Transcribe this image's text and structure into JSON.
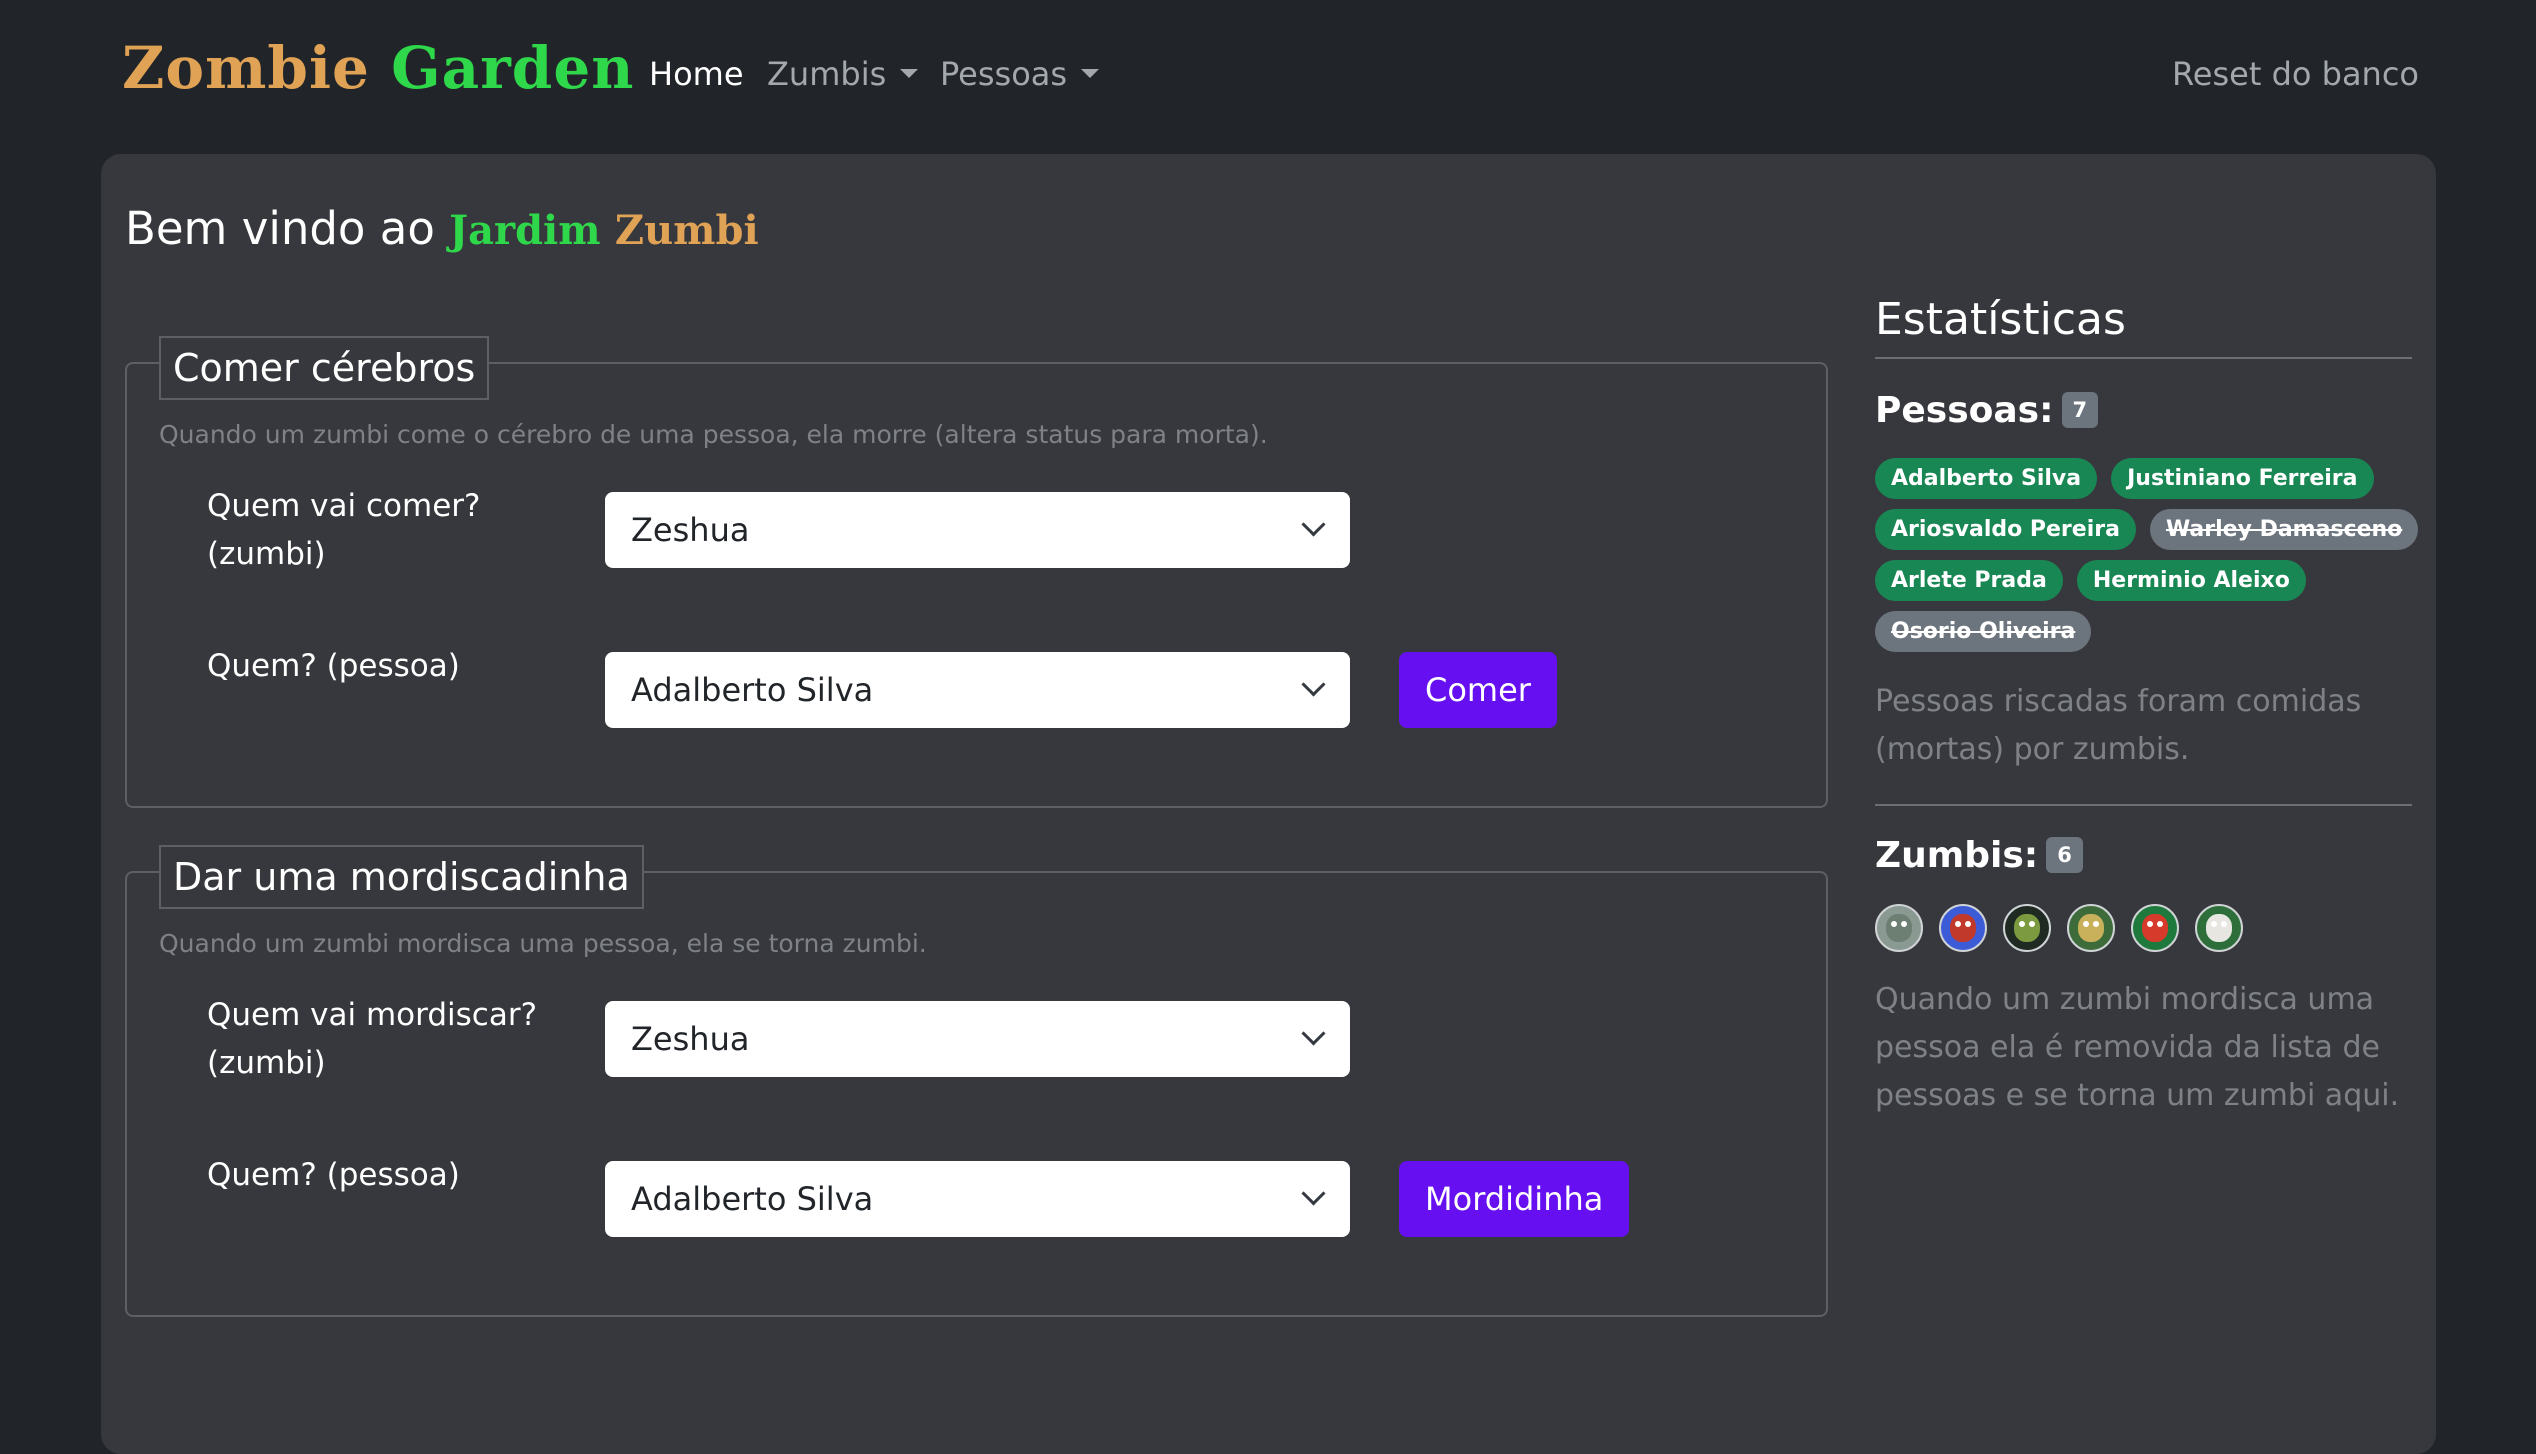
{
  "nav": {
    "brand_word1": "Zombie",
    "brand_word2": "Garden",
    "home": "Home",
    "zumbis": "Zumbis",
    "pessoas": "Pessoas",
    "reset": "Reset do banco"
  },
  "main": {
    "welcome_prefix": "Bem vindo ao",
    "welcome_jardim": "Jardim",
    "welcome_zumbi": "Zumbi"
  },
  "eat": {
    "legend": "Comer cérebros",
    "description": "Quando um zumbi come o cérebro de uma pessoa, ela morre (altera status para morta).",
    "zombie_label_line1": "Quem vai comer?",
    "zombie_label_line2": "(zumbi)",
    "zombie_value": "Zeshua",
    "person_label": "Quem? (pessoa)",
    "person_value": "Adalberto Silva",
    "button": "Comer"
  },
  "bite": {
    "legend": "Dar uma mordiscadinha",
    "description": "Quando um zumbi mordisca uma pessoa, ela se torna zumbi.",
    "zombie_label_line1": "Quem vai mordiscar?",
    "zombie_label_line2": "(zumbi)",
    "zombie_value": "Zeshua",
    "person_label": "Quem? (pessoa)",
    "person_value": "Adalberto Silva",
    "button": "Mordidinha"
  },
  "stats": {
    "title": "Estatísticas",
    "people_label": "Pessoas:",
    "people_count": "7",
    "people": [
      {
        "name": "Adalberto Silva",
        "status": "alive"
      },
      {
        "name": "Justiniano Ferreira",
        "status": "alive"
      },
      {
        "name": "Ariosvaldo Pereira",
        "status": "alive"
      },
      {
        "name": "Warley Damasceno",
        "status": "dead"
      },
      {
        "name": "Arlete Prada",
        "status": "alive"
      },
      {
        "name": "Herminio Aleixo",
        "status": "alive"
      },
      {
        "name": "Osorio Oliveira",
        "status": "dead"
      }
    ],
    "people_note": "Pessoas riscadas foram comidas (mortas) por zumbis.",
    "zombies_label": "Zumbis:",
    "zombies_count": "6",
    "zombie_avatars": [
      {
        "icon": "zombie-avatar-icon",
        "bg": "#8a9a92",
        "face": "#6d7f73"
      },
      {
        "icon": "zombie-avatar-icon",
        "bg": "#3c5bd6",
        "face": "#c0392b"
      },
      {
        "icon": "zombie-avatar-icon",
        "bg": "#1f2a22",
        "face": "#7c9a3f"
      },
      {
        "icon": "zombie-avatar-icon",
        "bg": "#3d6b3a",
        "face": "#c8b15a"
      },
      {
        "icon": "zombie-avatar-icon",
        "bg": "#1e7a3c",
        "face": "#d63a2a"
      },
      {
        "icon": "zombie-avatar-icon",
        "bg": "#2e6e3a",
        "face": "#e8e6e0"
      }
    ],
    "zombies_note": "Quando um zumbi mordisca uma pessoa ela é removida da lista de pessoas e se torna um zumbi aqui."
  },
  "colors": {
    "page_bg": "#212529",
    "card_bg": "#37383d",
    "accent_button": "#6610f2",
    "alive_badge": "#198754",
    "dead_badge": "#6c757d",
    "brand_orange": "#e0a255",
    "brand_green": "#2fd84a"
  }
}
